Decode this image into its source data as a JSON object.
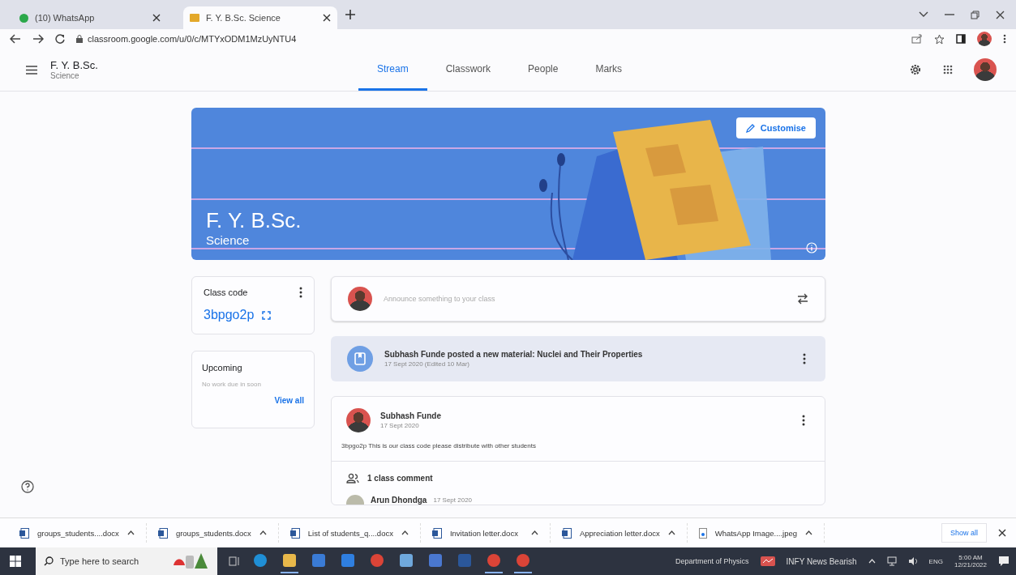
{
  "browser": {
    "tabs": [
      {
        "title": "(10) WhatsApp",
        "kind": "chat",
        "selected": false
      },
      {
        "title": "F. Y. B.Sc. Science",
        "kind": "classroom",
        "selected": true
      }
    ],
    "url": "classroom.google.com/u/0/c/MTYxODM1MzUyNTU4"
  },
  "header": {
    "title": "F. Y. B.Sc.",
    "subtitle": "Science",
    "nav": [
      {
        "label": "Stream",
        "selected": true
      },
      {
        "label": "Classwork",
        "selected": false
      },
      {
        "label": "People",
        "selected": false
      },
      {
        "label": "Marks",
        "selected": false
      }
    ]
  },
  "banner": {
    "title": "F. Y. B.Sc.",
    "subtitle": "Science",
    "button": "Customise"
  },
  "class_code": {
    "label": "Class code",
    "code": "3bpgo2p"
  },
  "upcoming": {
    "title": "Upcoming",
    "message": "No work due in soon",
    "link": "View all"
  },
  "composer": {
    "placeholder": "Announce something to your class"
  },
  "material": {
    "text": "Subhash Funde posted a new material: Nuclei and Their Properties",
    "date": "17 Sept 2020 (Edited 10 Mar)"
  },
  "post": {
    "author": "Subhash Funde",
    "date": "17 Sept 2020",
    "body": "3bpgo2p This is our class code please distribute with other students",
    "comments_label": "1 class comment",
    "comment": {
      "author": "Arun Dhondga",
      "date": "17 Sept 2020"
    }
  },
  "downloads": {
    "items": [
      {
        "name": "groups_students....docx",
        "kind": "doc"
      },
      {
        "name": "groups_students.docx",
        "kind": "doc"
      },
      {
        "name": "List of students_q....docx",
        "kind": "doc"
      },
      {
        "name": "Invitation letter.docx",
        "kind": "doc"
      },
      {
        "name": "Appreciation letter.docx",
        "kind": "doc"
      },
      {
        "name": "WhatsApp Image....jpeg",
        "kind": "image"
      }
    ],
    "show_all": "Show all"
  },
  "taskbar": {
    "search_placeholder": "Type here to search",
    "apps": [
      {
        "kind": "edge",
        "active": false
      },
      {
        "kind": "folder",
        "active": true
      },
      {
        "kind": "store",
        "active": false
      },
      {
        "kind": "mail",
        "active": false
      },
      {
        "kind": "chrome",
        "active": false
      },
      {
        "kind": "laptop",
        "active": false
      },
      {
        "kind": "app",
        "active": false
      },
      {
        "kind": "word",
        "active": false
      },
      {
        "kind": "chrome",
        "active": true
      },
      {
        "kind": "chrome",
        "active": true
      }
    ],
    "toolbar_label": "Department of Physics",
    "news": "INFY  News Bearish",
    "language": "ENG",
    "time": "5:00 AM",
    "date": "12/21/2022"
  }
}
